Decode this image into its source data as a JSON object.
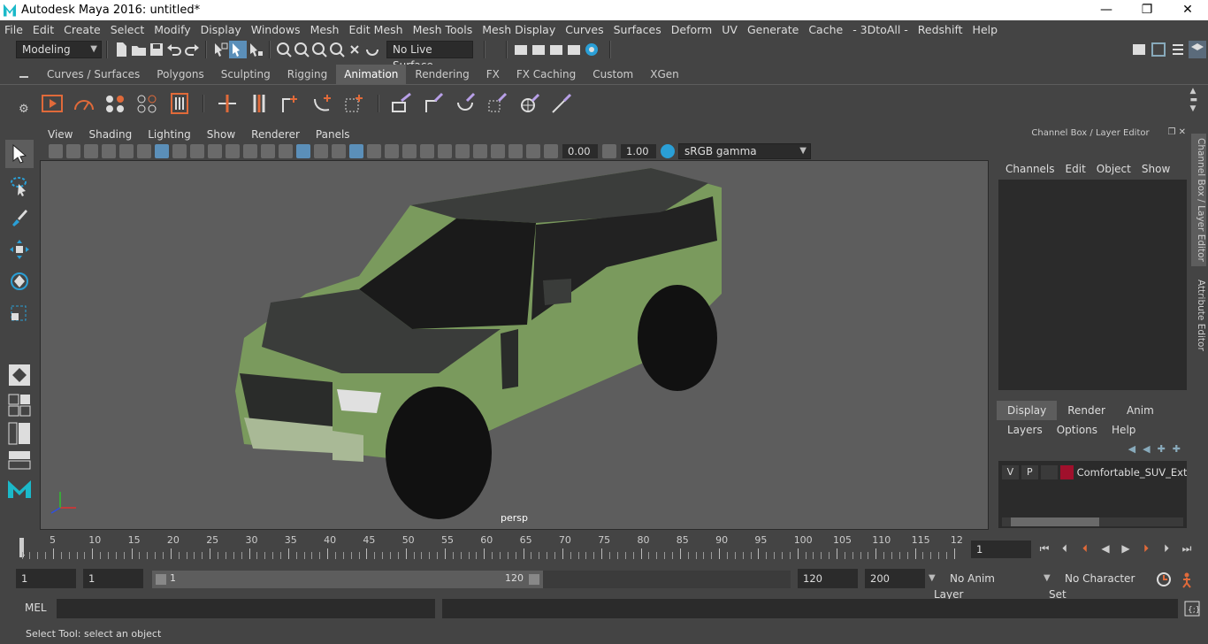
{
  "window": {
    "title": "Autodesk Maya 2016: untitled*",
    "controls": [
      "—",
      "❐",
      "✕"
    ]
  },
  "menu": [
    "File",
    "Edit",
    "Create",
    "Select",
    "Modify",
    "Display",
    "Windows",
    "Mesh",
    "Edit Mesh",
    "Mesh Tools",
    "Mesh Display",
    "Curves",
    "Surfaces",
    "Deform",
    "UV",
    "Generate",
    "Cache",
    "- 3DtoAll -",
    "Redshift",
    "Help"
  ],
  "statusline": {
    "mode": "Modeling",
    "live_surface": "No Live Surface"
  },
  "shelf": {
    "tabs": [
      "Curves / Surfaces",
      "Polygons",
      "Sculpting",
      "Rigging",
      "Animation",
      "Rendering",
      "FX",
      "FX Caching",
      "Custom",
      "XGen"
    ],
    "active_tab": "Animation"
  },
  "viewport": {
    "menu": [
      "View",
      "Shading",
      "Lighting",
      "Show",
      "Renderer",
      "Panels"
    ],
    "exposure": "0.00",
    "gamma": "1.00",
    "color_space": "sRGB gamma",
    "camera": "persp"
  },
  "channel_box": {
    "title": "Channel Box / Layer Editor",
    "menu": [
      "Channels",
      "Edit",
      "Object",
      "Show"
    ],
    "layer_tabs": [
      "Display",
      "Render",
      "Anim"
    ],
    "active_layer_tab": "Display",
    "layer_menu": [
      "Layers",
      "Options",
      "Help"
    ],
    "layer": {
      "visible": "V",
      "playback": "P",
      "name": "Comfortable_SUV_Exte",
      "color": "#a0102c"
    },
    "side_tabs": [
      "Channel Box / Layer Editor",
      "Attribute Editor"
    ]
  },
  "timeline": {
    "ticks": [
      "5",
      "10",
      "15",
      "20",
      "25",
      "30",
      "35",
      "40",
      "45",
      "50",
      "55",
      "60",
      "65",
      "70",
      "75",
      "80",
      "85",
      "90",
      "95",
      "100",
      "105",
      "110",
      "115",
      "12"
    ],
    "start_label": "1",
    "current_frame": "1"
  },
  "range": {
    "start": "1",
    "anim_start": "1",
    "slider_start": "1",
    "slider_end": "120",
    "end": "120",
    "anim_end": "200",
    "anim_layer": "No Anim Layer",
    "character_set": "No Character Set"
  },
  "command": {
    "label": "MEL"
  },
  "help_line": "Select Tool: select an object"
}
